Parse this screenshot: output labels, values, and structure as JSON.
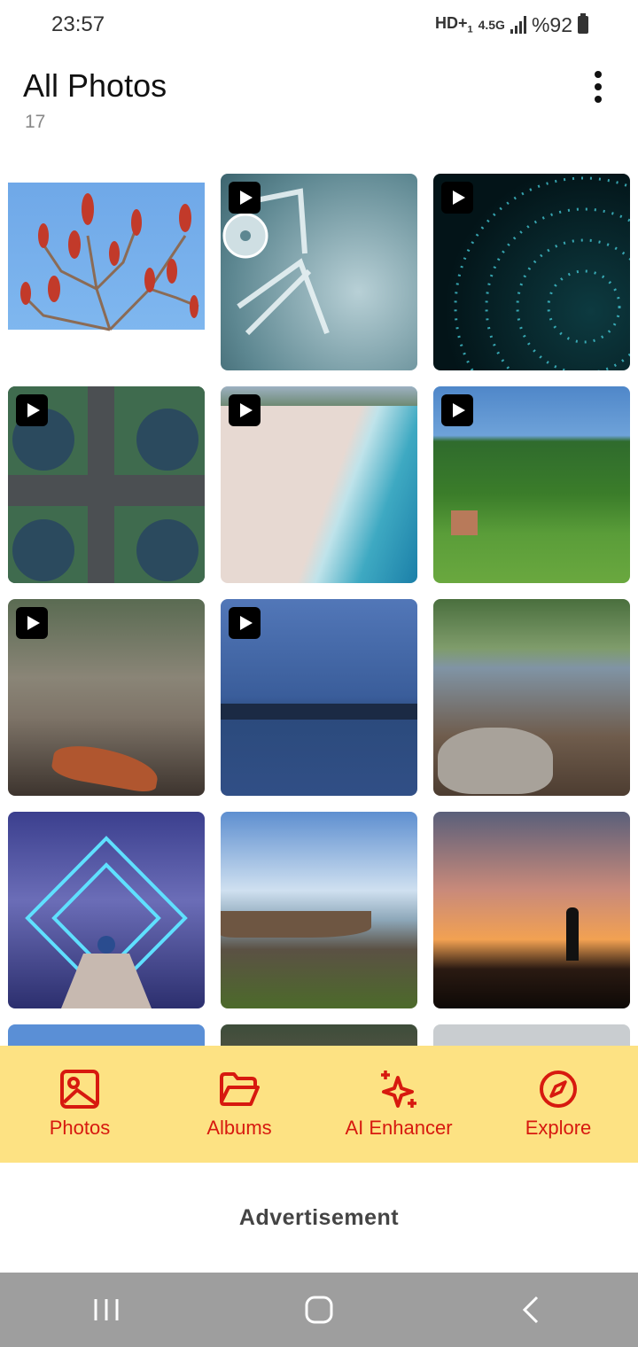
{
  "status_bar": {
    "time": "23:57",
    "network": "HD+",
    "network_sub": "1",
    "net_type": "4.5G",
    "battery": "%92"
  },
  "header": {
    "title": "All Photos",
    "count": "17"
  },
  "grid": {
    "items": [
      {
        "name": "photo-red-sumac-branches",
        "video": false
      },
      {
        "name": "video-director-chair",
        "video": true
      },
      {
        "name": "video-teal-particles",
        "video": true
      },
      {
        "name": "video-road-intersection",
        "video": true
      },
      {
        "name": "video-beach-aerial",
        "video": true
      },
      {
        "name": "video-countryside-field",
        "video": true
      },
      {
        "name": "video-blurred-rocks",
        "video": true
      },
      {
        "name": "video-lake-dusk",
        "video": true
      },
      {
        "name": "photo-rocky-lakeshore",
        "video": false
      },
      {
        "name": "photo-neon-portal-pier",
        "video": false
      },
      {
        "name": "photo-shipwreck-shore",
        "video": false
      },
      {
        "name": "photo-sunset-silhouette",
        "video": false
      },
      {
        "name": "photo-partial-1",
        "video": false
      },
      {
        "name": "photo-partial-2",
        "video": false
      },
      {
        "name": "photo-partial-3",
        "video": false
      }
    ]
  },
  "bottom_nav": {
    "items": [
      {
        "label": "Photos",
        "icon": "image-icon"
      },
      {
        "label": "Albums",
        "icon": "folder-icon"
      },
      {
        "label": "AI Enhancer",
        "icon": "sparkles-icon"
      },
      {
        "label": "Explore",
        "icon": "compass-icon"
      }
    ],
    "color": "#d7190f",
    "background": "#fde283"
  },
  "ad": {
    "label": "Advertisement"
  }
}
